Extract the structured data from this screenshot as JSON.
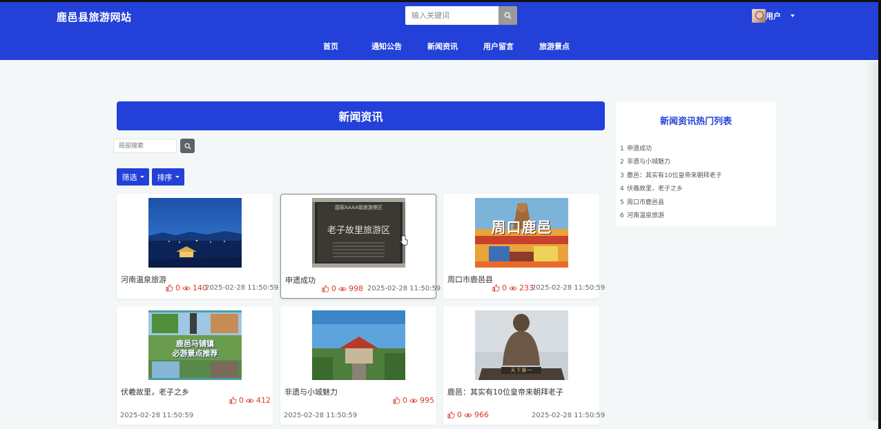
{
  "header": {
    "site_title": "鹿邑县旅游网站",
    "search_placeholder": "输入关键词",
    "user_label": "用户"
  },
  "nav": [
    {
      "label": "首页"
    },
    {
      "label": "通知公告"
    },
    {
      "label": "新闻资讯"
    },
    {
      "label": "用户留言"
    },
    {
      "label": "旅游景点"
    }
  ],
  "main": {
    "banner_title": "新闻资讯",
    "local_search_placeholder": "局部搜索",
    "filter_label": "筛选",
    "sort_label": "排序"
  },
  "cards": [
    {
      "title": "河南温泉旅游",
      "likes": "0",
      "views": "140",
      "date": "2025-02-28 11:50:59"
    },
    {
      "title": "申遗成功",
      "likes": "0",
      "views": "998",
      "date": "2025-02-28 11:50:59"
    },
    {
      "title": "周口市鹿邑县",
      "likes": "0",
      "views": "233",
      "date": "2025-02-28 11:50:59"
    },
    {
      "title": "伏羲故里，老子之乡",
      "likes": "0",
      "views": "412",
      "date": "2025-02-28 11:50:59"
    },
    {
      "title": "非遗与小城魅力",
      "likes": "0",
      "views": "995",
      "date": "2025-02-28 11:50:59"
    },
    {
      "title": "鹿邑：其实有10位皇帝来朝拜老子",
      "likes": "0",
      "views": "966",
      "date": "2025-02-28 11:50:59"
    }
  ],
  "thumb_text": {
    "card2_top": "国家AAAA级旅游景区",
    "card2_main": "老子故里旅游区",
    "card3_main": "周口鹿邑",
    "card4_line1": "鹿邑马铺镇",
    "card4_line2": "必游景点推荐",
    "card6_plaque": "天下第一"
  },
  "sidebar": {
    "title": "新闻资讯热门列表",
    "items": [
      {
        "num": "1",
        "label": "申遗成功"
      },
      {
        "num": "2",
        "label": "非遗与小城魅力"
      },
      {
        "num": "3",
        "label": "鹿邑：其实有10位皇帝来朝拜老子"
      },
      {
        "num": "4",
        "label": "伏羲故里，老子之乡"
      },
      {
        "num": "5",
        "label": "周口市鹿邑县"
      },
      {
        "num": "6",
        "label": "河南温泉旅游"
      }
    ]
  },
  "colors": {
    "primary": "#2340d8",
    "accent_red": "#d9392b",
    "page_bg": "#f3f7f8"
  }
}
